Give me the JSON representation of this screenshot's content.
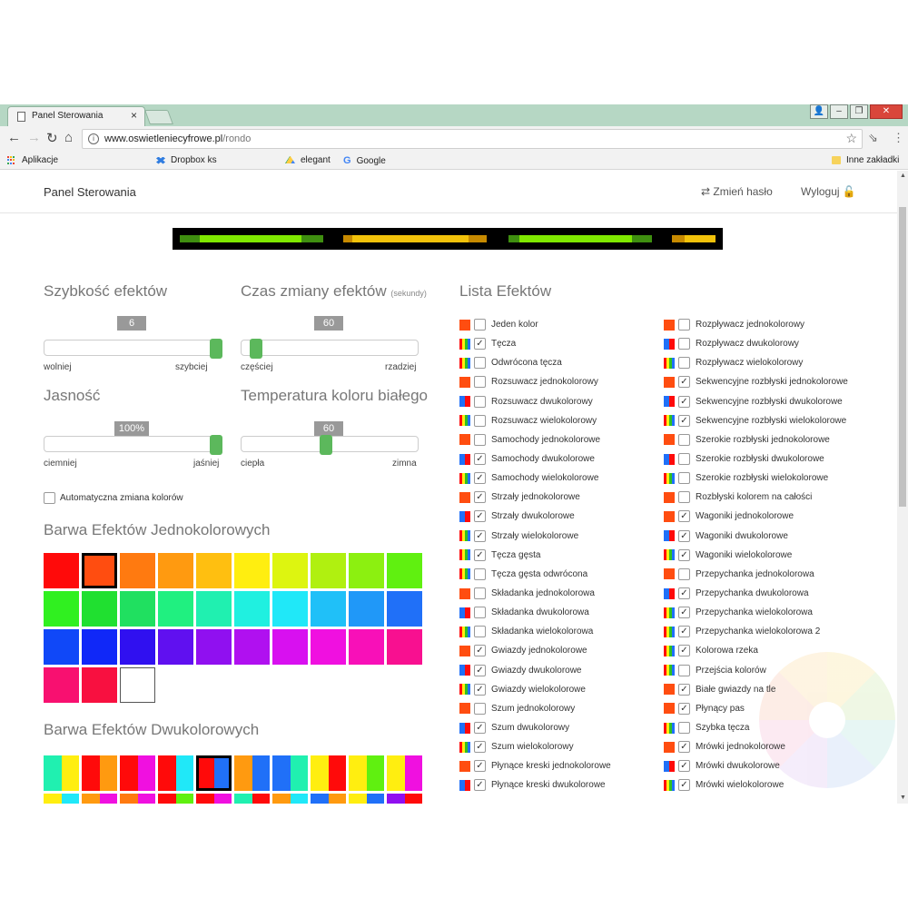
{
  "browser": {
    "tab_title": "Panel Sterowania",
    "tab_close": "×",
    "url_host": "www.oswietleniecyfrowe.pl",
    "url_path": "/rondo",
    "bookmarks": [
      {
        "label": "Aplikacje",
        "icon": "apps-grid-icon"
      },
      {
        "label": "Dropbox ks",
        "icon": "dropbox-icon"
      },
      {
        "label": "elegant",
        "icon": "drive-icon"
      },
      {
        "label": "Google",
        "icon": "google-icon"
      }
    ],
    "other_bookmarks": "Inne zakładki"
  },
  "nav": {
    "brand": "Panel Sterowania",
    "change_password": "⇄ Zmień hasło",
    "logout": "Wyloguj 🔓"
  },
  "preview_colors": {
    "green": "#7fe800",
    "dark_green": "#3f8f10",
    "yellow": "#f2c20a",
    "amber": "#c78a00"
  },
  "sliders": {
    "speed": {
      "title": "Szybkość efektów",
      "value": "6",
      "level": 1.0,
      "min_label": "wolniej",
      "max_label": "szybciej"
    },
    "interval": {
      "title": "Czas zmiany efektów",
      "unit": "(sekundy)",
      "value": "60",
      "level": 0.05,
      "min_label": "częściej",
      "max_label": "rzadziej"
    },
    "brightness": {
      "title": "Jasność",
      "value": "100%",
      "level": 1.0,
      "min_label": "ciemniej",
      "max_label": "jaśniej"
    },
    "temperature": {
      "title": "Temperatura koloru białego",
      "value": "60",
      "level": 0.47,
      "min_label": "ciepła",
      "max_label": "zimna"
    }
  },
  "auto_color_label": "Automatyczna zmiana kolorów",
  "mono_title": "Barwa Efektów Jednokolorowych",
  "mono_colors": [
    "#ff0a0a",
    "#ff4d10",
    "#ff7a10",
    "#ff9a10",
    "#ffbf10",
    "#ffee10",
    "#ddf510",
    "#b0f010",
    "#8cf010",
    "#60f010",
    "#30f020",
    "#20e030",
    "#20e060",
    "#20f080",
    "#20f0b0",
    "#20f0e0",
    "#20e8f8",
    "#20c0f8",
    "#2098f8",
    "#2070f8",
    "#1048f8",
    "#1028f8",
    "#3010f0",
    "#6010f0",
    "#9010f0",
    "#b010f0",
    "#d810f0",
    "#f010e0",
    "#f810b8",
    "#f81090",
    "#f81070",
    "#f81040",
    "#ffffff"
  ],
  "mono_selected": 1,
  "duo_title": "Barwa Efektów Dwukolorowych",
  "duo_colors": [
    [
      "#20f0b0",
      "#ffee10"
    ],
    [
      "#ff0a0a",
      "#ff9a10"
    ],
    [
      "#ff0a0a",
      "#f010e0"
    ],
    [
      "#ff0a0a",
      "#20e8f8"
    ],
    [
      "#ff0a0a",
      "#2070f8"
    ],
    [
      "#ff9a10",
      "#2070f8"
    ],
    [
      "#2070f8",
      "#20f0b0"
    ],
    [
      "#ffee10",
      "#ff0a0a"
    ],
    [
      "#ffee10",
      "#60f010"
    ],
    [
      "#ffee10",
      "#f010e0"
    ],
    [
      "#ffee10",
      "#20e8f8"
    ],
    [
      "#ff9a10",
      "#f010e0"
    ],
    [
      "#ff7a10",
      "#f010e0"
    ],
    [
      "#ff0a0a",
      "#60f010"
    ],
    [
      "#ff0a0a",
      "#f010e0"
    ],
    [
      "#20f0b0",
      "#ff0a0a"
    ],
    [
      "#ff9a10",
      "#20e8f8"
    ],
    [
      "#2070f8",
      "#ff9a10"
    ],
    [
      "#ffee10",
      "#2070f8"
    ],
    [
      "#9010f0",
      "#ff0a0a"
    ]
  ],
  "duo_selected": 4,
  "effects_title": "Lista Efektów",
  "effects_left": [
    {
      "name": "Jeden kolor",
      "type": "mono",
      "checked": false
    },
    {
      "name": "Tęcza",
      "type": "multi",
      "checked": true
    },
    {
      "name": "Odwrócona tęcza",
      "type": "multi",
      "checked": false
    },
    {
      "name": "Rozsuwacz jednokolorowy",
      "type": "mono",
      "checked": false
    },
    {
      "name": "Rozsuwacz dwukolorowy",
      "type": "duo",
      "checked": false
    },
    {
      "name": "Rozsuwacz wielokolorowy",
      "type": "multi",
      "checked": false
    },
    {
      "name": "Samochody jednokolorowe",
      "type": "mono",
      "checked": false
    },
    {
      "name": "Samochody dwukolorowe",
      "type": "duo",
      "checked": true
    },
    {
      "name": "Samochody wielokolorowe",
      "type": "multi",
      "checked": true
    },
    {
      "name": "Strzały jednokolorowe",
      "type": "mono",
      "checked": true
    },
    {
      "name": "Strzały dwukolorowe",
      "type": "duo",
      "checked": true
    },
    {
      "name": "Strzały wielokolorowe",
      "type": "multi",
      "checked": true
    },
    {
      "name": "Tęcza gęsta",
      "type": "multi",
      "checked": true
    },
    {
      "name": "Tęcza gęsta odwrócona",
      "type": "multi",
      "checked": false
    },
    {
      "name": "Składanka jednokolorowa",
      "type": "mono",
      "checked": false
    },
    {
      "name": "Składanka dwukolorowa",
      "type": "duo",
      "checked": false
    },
    {
      "name": "Składanka wielokolorowa",
      "type": "multi",
      "checked": false
    },
    {
      "name": "Gwiazdy jednokolorowe",
      "type": "mono",
      "checked": true
    },
    {
      "name": "Gwiazdy dwukolorowe",
      "type": "duo",
      "checked": true
    },
    {
      "name": "Gwiazdy wielokolorowe",
      "type": "multi",
      "checked": true
    },
    {
      "name": "Szum jednokolorowy",
      "type": "mono",
      "checked": false
    },
    {
      "name": "Szum dwukolorowy",
      "type": "duo",
      "checked": true
    },
    {
      "name": "Szum wielokolorowy",
      "type": "multi",
      "checked": true
    },
    {
      "name": "Płynące kreski jednokolorowe",
      "type": "mono",
      "checked": true
    },
    {
      "name": "Płynące kreski dwukolorowe",
      "type": "duo",
      "checked": true
    }
  ],
  "effects_right": [
    {
      "name": "Rozpływacz jednokolorowy",
      "type": "mono",
      "checked": false
    },
    {
      "name": "Rozpływacz dwukolorowy",
      "type": "duo",
      "checked": false
    },
    {
      "name": "Rozpływacz wielokolorowy",
      "type": "multi",
      "checked": false
    },
    {
      "name": "Sekwencyjne rozbłyski jednokolorowe",
      "type": "mono",
      "checked": true
    },
    {
      "name": "Sekwencyjne rozbłyski dwukolorowe",
      "type": "duo",
      "checked": true
    },
    {
      "name": "Sekwencyjne rozbłyski wielokolorowe",
      "type": "multi",
      "checked": true
    },
    {
      "name": "Szerokie rozbłyski jednokolorowe",
      "type": "mono",
      "checked": false
    },
    {
      "name": "Szerokie rozbłyski dwukolorowe",
      "type": "duo",
      "checked": false
    },
    {
      "name": "Szerokie rozbłyski wielokolorowe",
      "type": "multi",
      "checked": false
    },
    {
      "name": "Rozbłyski kolorem na całości",
      "type": "mono",
      "checked": false
    },
    {
      "name": "Wagoniki jednokolorowe",
      "type": "mono",
      "checked": true
    },
    {
      "name": "Wagoniki dwukolorowe",
      "type": "duo",
      "checked": true
    },
    {
      "name": "Wagoniki wielokolorowe",
      "type": "multi",
      "checked": true
    },
    {
      "name": "Przepychanka jednokolorowa",
      "type": "mono",
      "checked": false
    },
    {
      "name": "Przepychanka dwukolorowa",
      "type": "duo",
      "checked": true
    },
    {
      "name": "Przepychanka wielokolorowa",
      "type": "multi",
      "checked": true
    },
    {
      "name": "Przepychanka wielokolorowa 2",
      "type": "multi",
      "checked": true
    },
    {
      "name": "Kolorowa rzeka",
      "type": "multi",
      "checked": true
    },
    {
      "name": "Przejścia kolorów",
      "type": "multi",
      "checked": false
    },
    {
      "name": "Białe gwiazdy na tle",
      "type": "mono",
      "checked": true
    },
    {
      "name": "Płynący pas",
      "type": "mono",
      "checked": true
    },
    {
      "name": "Szybka tęcza",
      "type": "multi",
      "checked": false
    },
    {
      "name": "Mrówki jednokolorowe",
      "type": "mono",
      "checked": true
    },
    {
      "name": "Mrówki dwukolorowe",
      "type": "duo",
      "checked": true
    },
    {
      "name": "Mrówki wielokolorowe",
      "type": "multi",
      "checked": true
    }
  ],
  "icon_palettes": {
    "mono": [
      "#ff4d10"
    ],
    "duo": [
      "#2070f8",
      "#ff0a0a"
    ],
    "multi": [
      "#ff0a0a",
      "#ffee10",
      "#30c020",
      "#2070f8"
    ]
  },
  "check_mark": "✓"
}
